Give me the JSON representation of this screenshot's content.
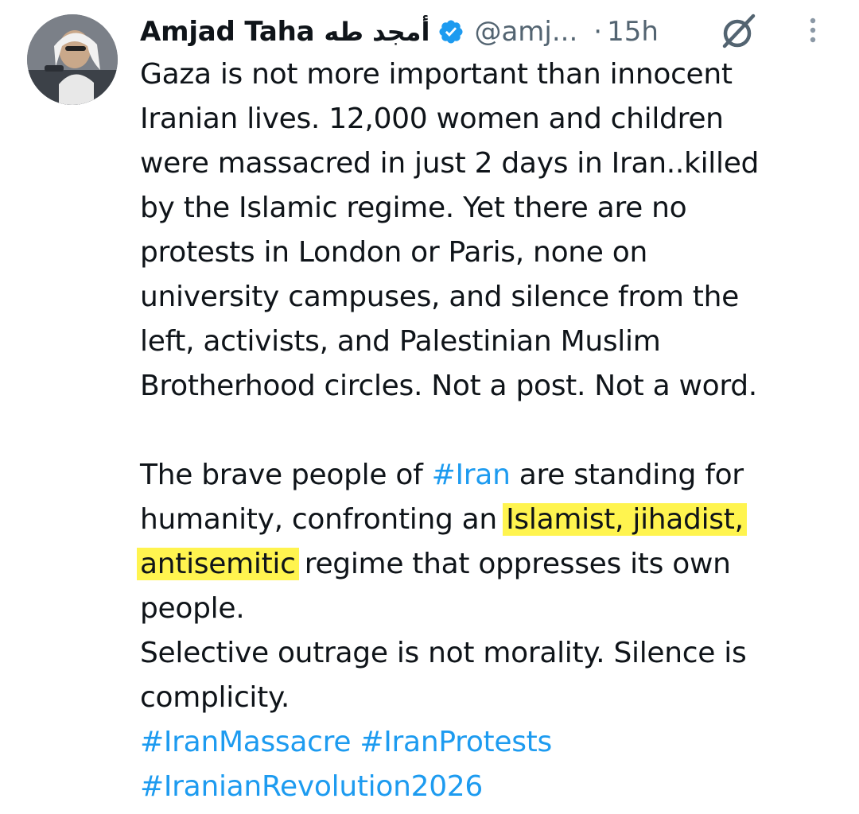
{
  "tweet": {
    "author": {
      "display_name": "Amjad Taha",
      "arabic_name": "أمجد طه",
      "handle": "@amj...",
      "verified": true
    },
    "separator": "·",
    "time": "15h",
    "icons": {
      "grok": "grok-icon",
      "more": "more-options-icon",
      "verified": "verified-badge-icon"
    },
    "body": {
      "p1": [
        "Gaza is not more important than innocent",
        "Iranian lives. 12,000 women and children",
        "were massacred in just 2 days in Iran..killed",
        "by the Islamic regime. Yet there are no",
        "protests in London or Paris, none on",
        "university campuses, and silence from the",
        "left, activists, and Palestinian Muslim",
        "Brotherhood circles. Not a post. Not a word."
      ],
      "p2_l1_pre": "The brave people of ",
      "p2_l1_tag": "#Iran",
      "p2_l1_post": " are standing for",
      "p2_l2_pre": "humanity, confronting an ",
      "p2_l2_hl": "Islamist, jihadist,",
      "p2_l3_hl": "antisemitic",
      "p2_l3_post": " regime that oppresses its own",
      "p2_l4": "people.",
      "p3_l1": "Selective outrage is not morality. Silence is",
      "p3_l2": "complicity.",
      "hashtags": [
        "#IranMassacre",
        "#IranProtests",
        "#IranianRevolution2026"
      ]
    },
    "colors": {
      "link": "#1d9bf0",
      "verified": "#1d9bf0",
      "muted": "#536471",
      "highlight": "#fff44f"
    }
  }
}
